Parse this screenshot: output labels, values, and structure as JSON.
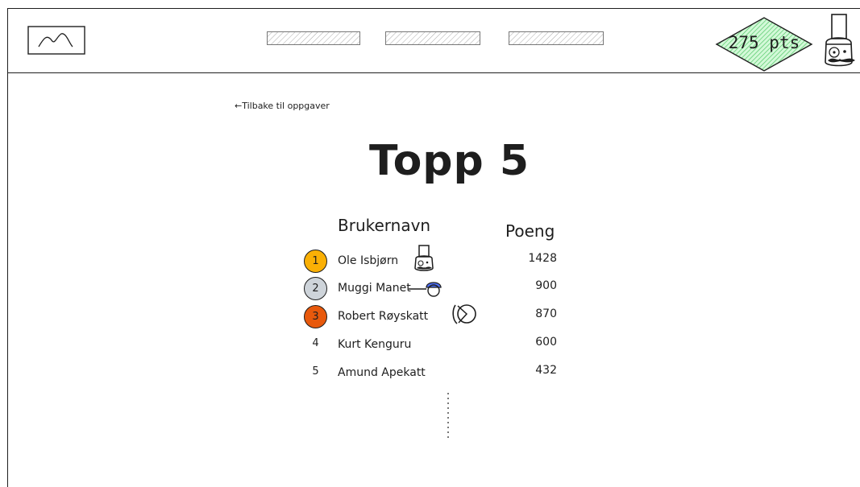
{
  "header": {
    "logo_icon": "image-placeholder-icon",
    "nav_items": [
      "",
      "",
      ""
    ],
    "points": "275 pts",
    "points_color": "#b2f2bb",
    "avatar_icon": "chef-avatar-icon"
  },
  "back_link": "←Tilbake til oppgaver",
  "title": "Topp 5",
  "table": {
    "headers": {
      "username": "Brukernavn",
      "score": "Poeng"
    },
    "rows": [
      {
        "rank": "1",
        "name": "Ole Isbjørn",
        "score": "1428",
        "badge_color": "#fab005",
        "icon": "chef-icon"
      },
      {
        "rank": "2",
        "name": "Muggi Manet",
        "score": "900",
        "badge_color": "#ced4da",
        "icon": "jellyfish-icon"
      },
      {
        "rank": "3",
        "name": "Robert Røyskatt",
        "score": "870",
        "badge_color": "#e8590c",
        "icon": "weasel-icon"
      },
      {
        "rank": "4",
        "name": "Kurt Kenguru",
        "score": "600",
        "badge_color": "",
        "icon": ""
      },
      {
        "rank": "5",
        "name": "Amund Apekatt",
        "score": "432",
        "badge_color": "",
        "icon": ""
      }
    ]
  }
}
